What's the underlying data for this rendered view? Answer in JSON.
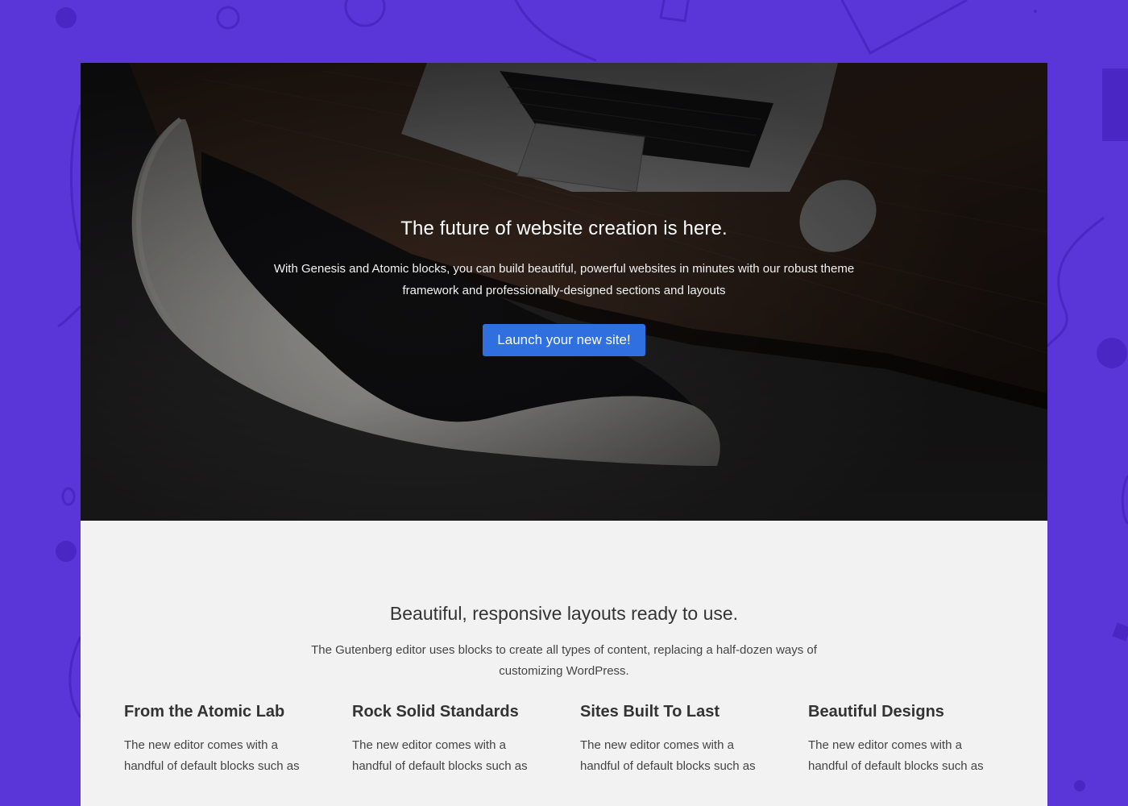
{
  "colors": {
    "background": "#5a35d8",
    "button": "#2f6fe0",
    "section_bg": "#f2f2f2"
  },
  "hero": {
    "title": "The future of website creation is here.",
    "text": "With Genesis and Atomic blocks, you can build beautiful, powerful websites in minutes with our robust theme framework and professionally-designed sections and layouts",
    "button_label": "Launch your new site!"
  },
  "section": {
    "title": "Beautiful, responsive layouts ready to use.",
    "text": "The Gutenberg editor uses blocks to create all types of content, replacing a half-dozen ways of customizing WordPress."
  },
  "features": [
    {
      "title": "From the Atomic Lab",
      "text": "The new editor comes with a handful of default blocks such as"
    },
    {
      "title": "Rock Solid Standards",
      "text": "The new editor comes with a handful of default blocks such as"
    },
    {
      "title": "Sites Built To Last",
      "text": "The new editor comes with a handful of default blocks such as"
    },
    {
      "title": "Beautiful Designs",
      "text": "The new editor comes with a handful of default blocks such as"
    }
  ]
}
